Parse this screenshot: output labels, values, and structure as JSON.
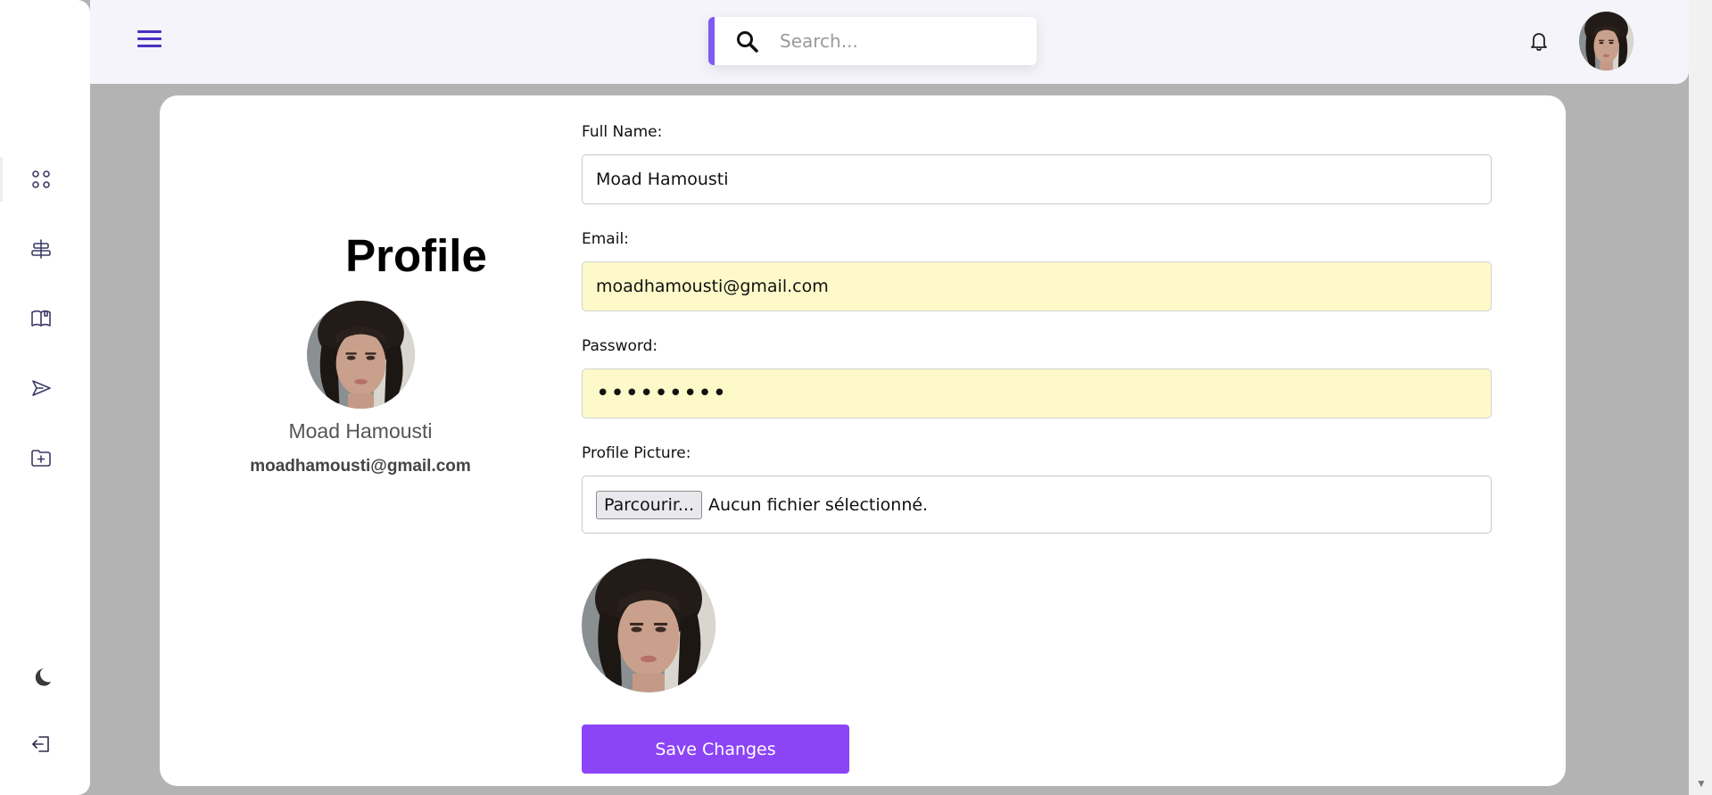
{
  "search": {
    "placeholder": "Search..."
  },
  "profile": {
    "title": "Profile",
    "name": "Moad Hamousti",
    "email": "moadhamousti@gmail.com"
  },
  "form": {
    "full_name_label": "Full Name:",
    "full_name_value": "Moad Hamousti",
    "email_label": "Email:",
    "email_value": "moadhamousti@gmail.com",
    "password_label": "Password:",
    "password_value": "•••••••••",
    "picture_label": "Profile Picture:",
    "browse_button": "Parcourir...",
    "file_status": "Aucun fichier sélectionné.",
    "save_button": "Save Changes"
  },
  "sidebar": {
    "items": [
      {
        "icon": "dashboard-icon"
      },
      {
        "icon": "align-center-icon"
      },
      {
        "icon": "book-icon"
      },
      {
        "icon": "send-icon"
      },
      {
        "icon": "folder-add-icon"
      }
    ],
    "bottom": [
      {
        "icon": "moon-icon"
      },
      {
        "icon": "logout-icon"
      }
    ]
  },
  "colors": {
    "accent": "#8c44f7",
    "search_accent": "#7c5cf2",
    "menu_icon": "#4b2fc2",
    "autofill_bg": "#fdf9c9"
  }
}
